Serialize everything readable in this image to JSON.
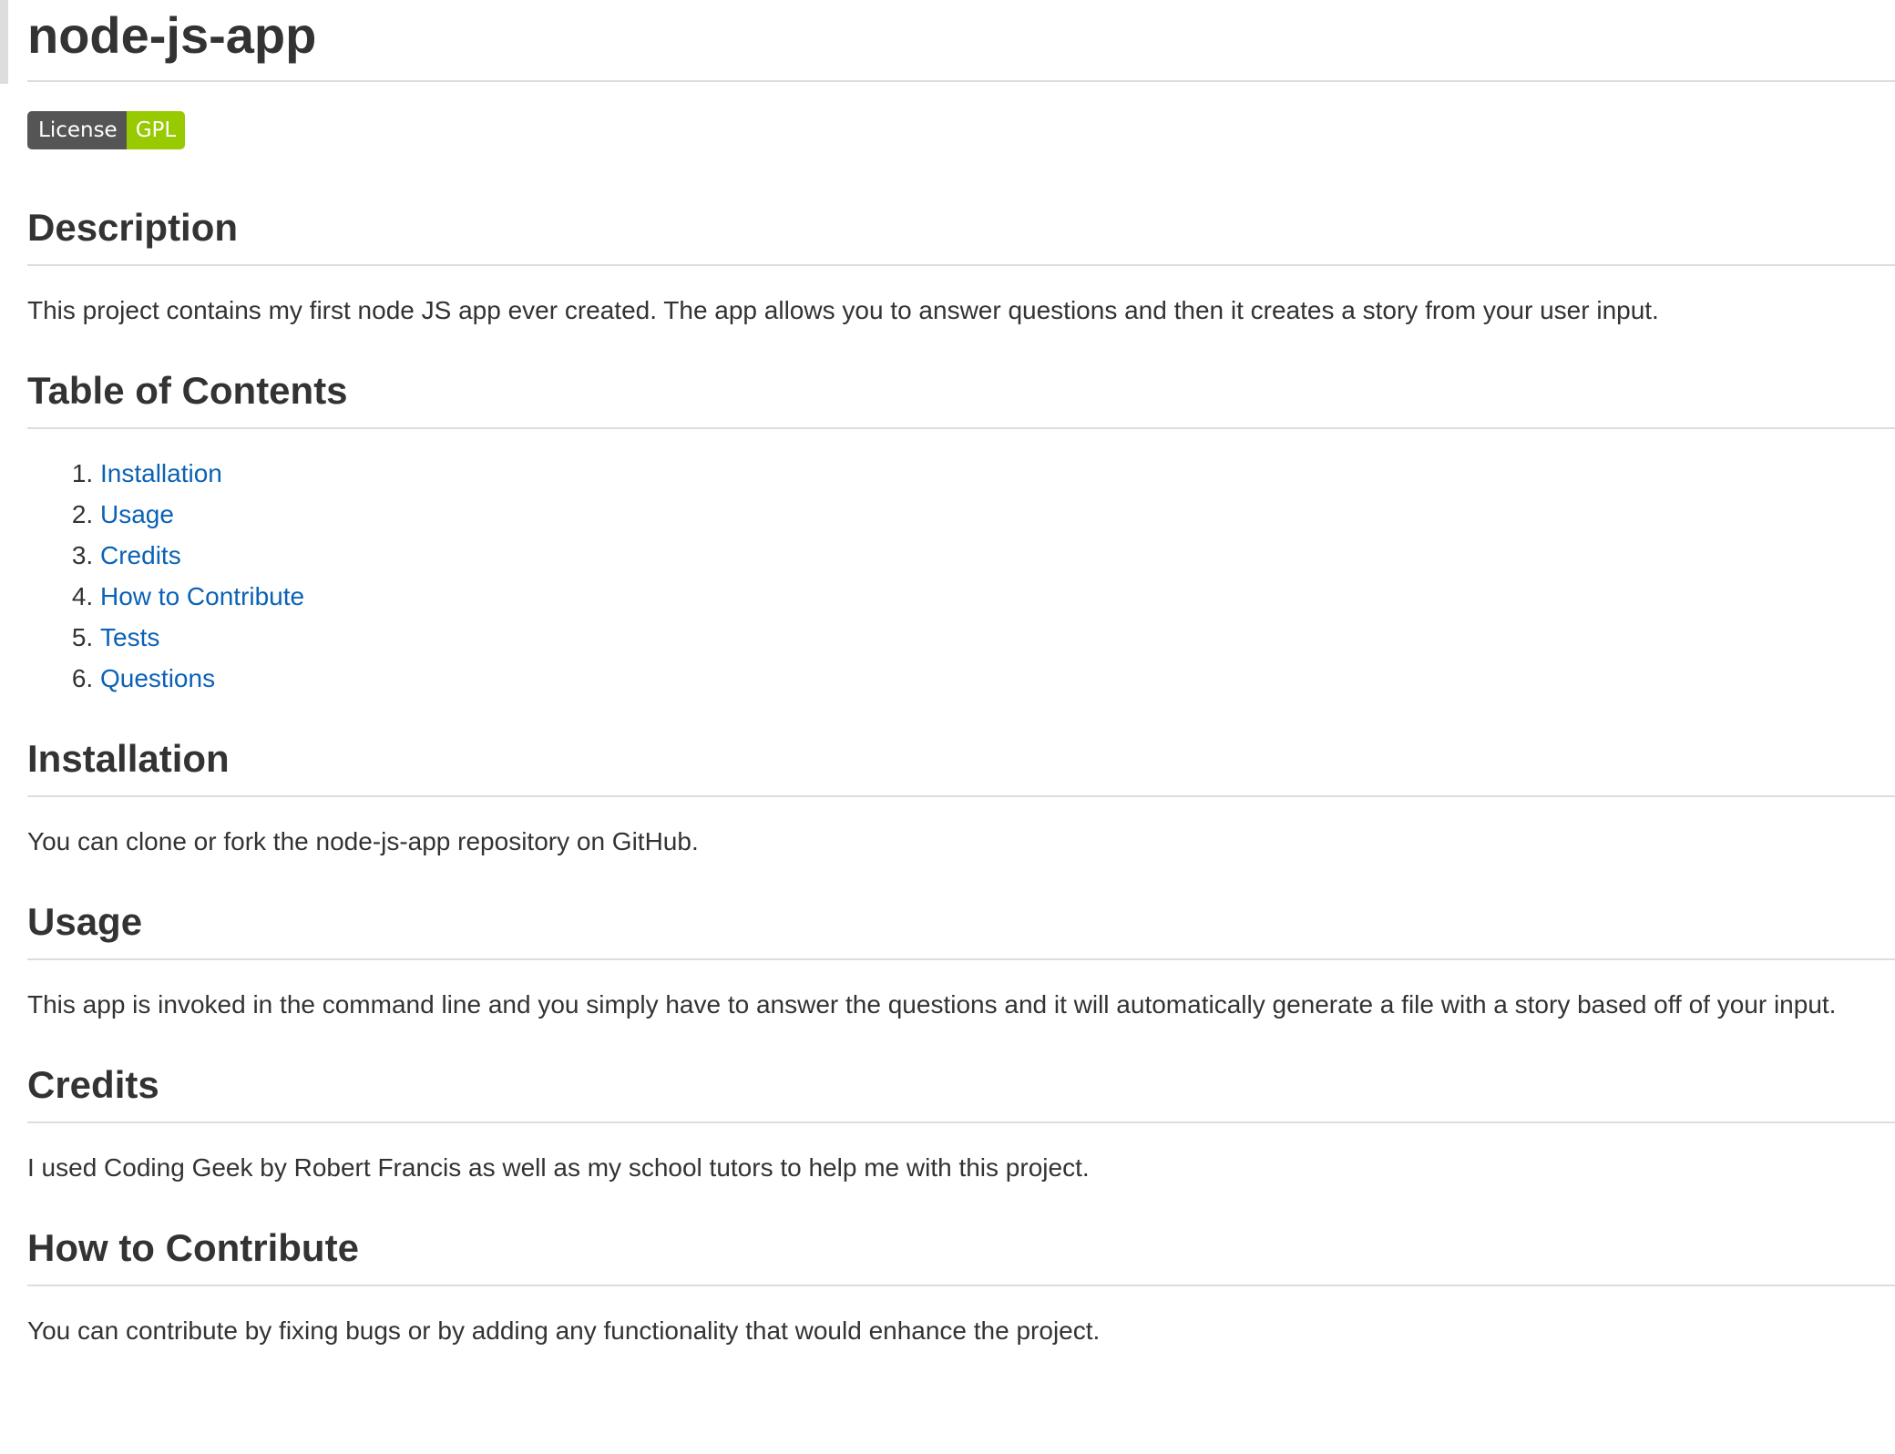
{
  "title": "node-js-app",
  "badge": {
    "label": "License",
    "value": "GPL",
    "color_left": "#555555",
    "color_right": "#97ca00"
  },
  "sections": {
    "description": {
      "heading": "Description",
      "text": "This project contains my first node JS app ever created. The app allows you to answer questions and then it creates a story from your user input."
    },
    "toc": {
      "heading": "Table of Contents",
      "items": [
        "Installation",
        "Usage",
        "Credits",
        "How to Contribute",
        "Tests",
        "Questions"
      ]
    },
    "installation": {
      "heading": "Installation",
      "text": "You can clone or fork the node-js-app repository on GitHub."
    },
    "usage": {
      "heading": "Usage",
      "text": "This app is invoked in the command line and you simply have to answer the questions and it will automatically generate a file with a story based off of your input."
    },
    "credits": {
      "heading": "Credits",
      "text": "I used Coding Geek by Robert Francis as well as my school tutors to help me with this project."
    },
    "contribute": {
      "heading": "How to Contribute",
      "text": "You can contribute by fixing bugs or by adding any functionality that would enhance the project."
    }
  },
  "colors": {
    "link": "#0b62b5",
    "text": "#333333",
    "rule": "#dddddd"
  }
}
